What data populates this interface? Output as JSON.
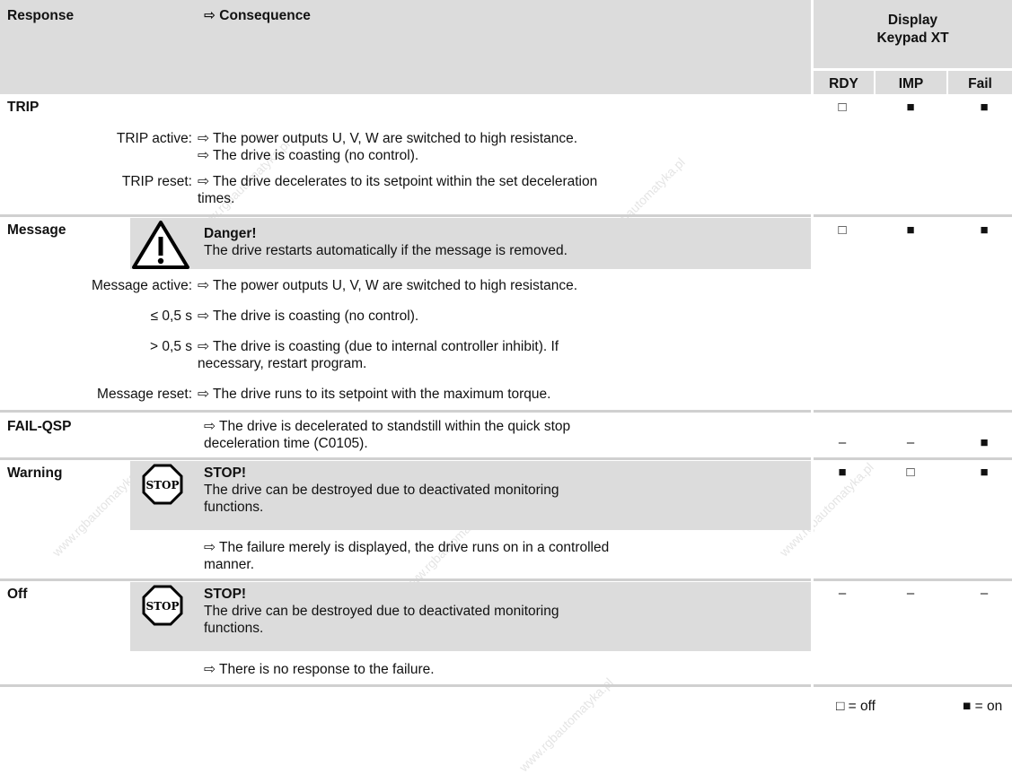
{
  "header": {
    "response": "Response",
    "consequence": "⇨ Consequence",
    "display_line1": "Display",
    "display_line2": "Keypad XT",
    "col_rdy": "RDY",
    "col_imp": "IMP",
    "col_fail": "Fail"
  },
  "trip": {
    "label": "TRIP",
    "active_label": "TRIP active:",
    "active_1": "⇨ The power outputs U, V, W are switched to high resistance.",
    "active_2": "⇨ The drive is coasting (no control).",
    "reset_label": "TRIP reset:",
    "reset_1": "⇨ The drive decelerates to its setpoint within the set deceleration",
    "reset_2": "times.",
    "rdy": "□",
    "imp": "■",
    "fail": "■"
  },
  "message": {
    "label": "Message",
    "danger_title": "Danger!",
    "danger_text": "The drive restarts automatically if the message is removed.",
    "active_label": "Message active:",
    "active_text": "⇨ The power outputs U, V, W are switched to high resistance.",
    "le_label": "≤ 0,5 s",
    "le_text": "⇨ The drive is coasting (no control).",
    "gt_label": "> 0,5 s",
    "gt_1": "⇨ The drive is coasting (due to internal controller inhibit). If",
    "gt_2": "necessary, restart program.",
    "reset_label": "Message reset:",
    "reset_text": "⇨ The drive runs to its setpoint with the maximum torque.",
    "rdy": "□",
    "imp": "■",
    "fail": "■"
  },
  "failqsp": {
    "label": "FAIL-QSP",
    "text_1": "⇨ The drive is decelerated to standstill within the quick stop",
    "text_2": "deceleration time (C0105).",
    "rdy": "–",
    "imp": "–",
    "fail": "■"
  },
  "warning": {
    "label": "Warning",
    "icon_text": "STOP",
    "stop_title": "STOP!",
    "stop_1": "The drive can be destroyed due to deactivated monitoring",
    "stop_2": "functions.",
    "text_1": "⇨ The failure merely is displayed, the drive runs on in a controlled",
    "text_2": "manner.",
    "rdy": "■",
    "imp": "□",
    "fail": "■"
  },
  "off": {
    "label": "Off",
    "icon_text": "STOP",
    "stop_title": "STOP!",
    "stop_1": "The drive can be destroyed due to deactivated monitoring",
    "stop_2": "functions.",
    "text_1": "⇨ There is no response to the failure.",
    "rdy": "–",
    "imp": "–",
    "fail": "–"
  },
  "legend": {
    "off": "□ = off",
    "on": "■ = on"
  },
  "watermark": "www.rgbautomatyka.pl"
}
